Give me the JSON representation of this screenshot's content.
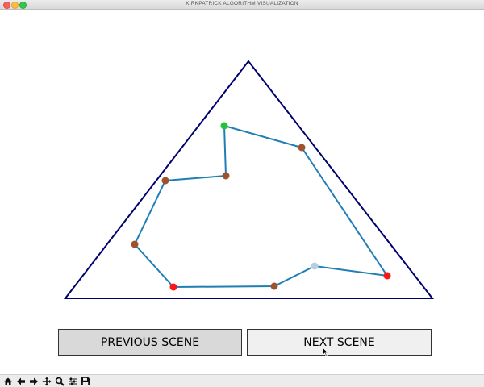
{
  "window": {
    "title": "KIRKPATRICK ALGORITHM VISUALIZATION"
  },
  "buttons": {
    "previous_label": "PREVIOUS SCENE",
    "next_label": "NEXT SCENE"
  },
  "toolbar": {
    "icons": [
      "home-icon",
      "back-icon",
      "forward-icon",
      "pan-icon",
      "zoom-icon",
      "configure-subplots-icon",
      "save-icon"
    ]
  },
  "colors": {
    "triangle": "#00006e",
    "polygon_edge": "#1f7fb4",
    "vertex_default": "#a0522d",
    "vertex_start": "#22c33a",
    "vertex_marked": "#ff1414",
    "vertex_light": "#b8cde0"
  }
}
